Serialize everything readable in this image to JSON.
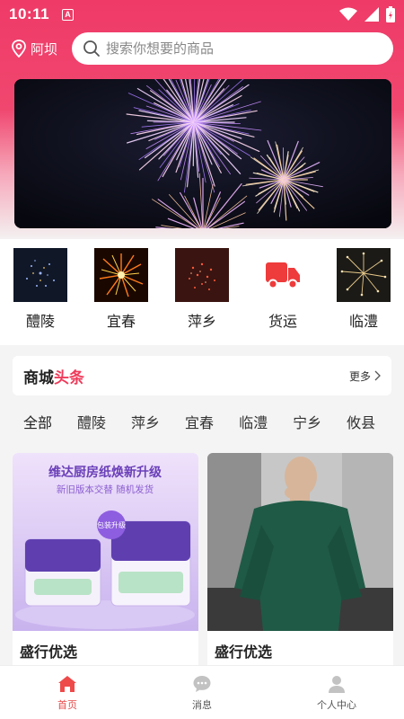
{
  "status_bar": {
    "time": "10:11",
    "indicator": "A"
  },
  "header": {
    "location": "阿坝",
    "search_placeholder": "搜索你想要的商品"
  },
  "categories": [
    {
      "label": "醴陵",
      "icon": "firework-photo"
    },
    {
      "label": "宜春",
      "icon": "firework-photo"
    },
    {
      "label": "萍乡",
      "icon": "firework-photo"
    },
    {
      "label": "货运",
      "icon": "truck-icon"
    },
    {
      "label": "临澧",
      "icon": "firework-photo"
    }
  ],
  "headline": {
    "title_part1": "商城",
    "title_part2": "头条",
    "more": "更多"
  },
  "tabs": [
    "全部",
    "醴陵",
    "萍乡",
    "宜春",
    "临澧",
    "宁乡",
    "攸县"
  ],
  "products": [
    {
      "title": "盛行优选",
      "image_heading": "维达厨房纸焕新升级",
      "image_subheading": "新旧版本交替  随机发货",
      "badge": "包装升级"
    },
    {
      "title": "盛行优选"
    }
  ],
  "bottom_nav": [
    {
      "label": "首页",
      "icon": "home-icon",
      "active": true
    },
    {
      "label": "消息",
      "icon": "message-icon",
      "active": false
    },
    {
      "label": "个人中心",
      "icon": "user-icon",
      "active": false
    }
  ],
  "colors": {
    "brand": "#ef3a67",
    "accent_text": "#ef3a5a",
    "tab_underline": "#e8472b",
    "nav_active": "#e74a4a",
    "truck": "#ee3b3b"
  }
}
